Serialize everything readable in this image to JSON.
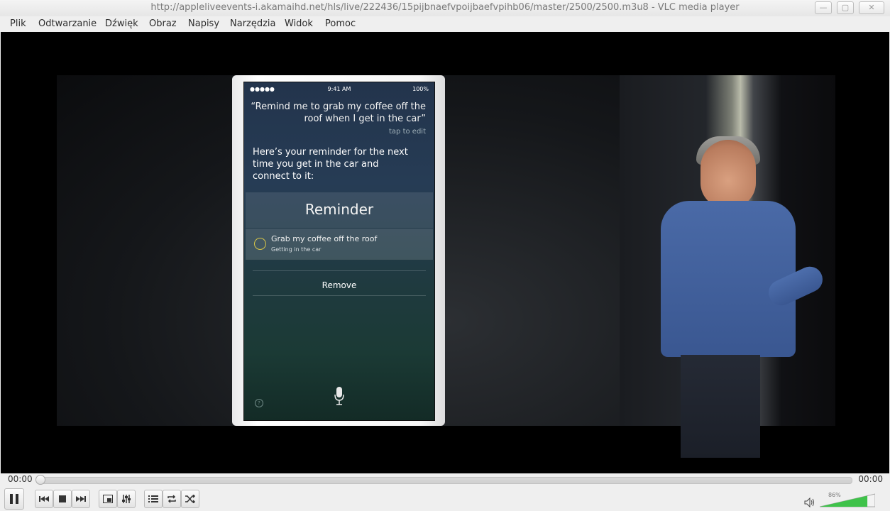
{
  "window": {
    "title": "http://appleliveevents-i.akamaihd.net/hls/live/222436/15pijbnaefvpoijbaefvpihb06/master/2500/2500.m3u8 - VLC media player",
    "buttons": {
      "minimize": "—",
      "maximize": "▢",
      "close": "✕"
    }
  },
  "menu": [
    "Plik",
    "Odtwarzanie",
    "Dźwięk",
    "Obraz",
    "Napisy",
    "Narzędzia",
    "Widok",
    "Pomoc"
  ],
  "video": {
    "phone": {
      "status_time": "9:41 AM",
      "status_signal": "●●●●● ",
      "status_battery": "100%",
      "quote": "“Remind me to grab my coffee off the roof when I get in the car”",
      "tap_to_edit": "tap to edit",
      "answer": "Here’s your reminder for the next time you get in the car and connect to it:",
      "card_title": "Reminder",
      "item_title": "Grab my coffee off the roof",
      "item_subtitle": "Getting in the car",
      "remove_label": "Remove",
      "help_glyph": "?"
    }
  },
  "playback": {
    "elapsed": "00:00",
    "total": "00:00",
    "progress": 0,
    "volume_percent": "86%",
    "volume_level": 0.86
  },
  "icons": {
    "pause": "pause-icon",
    "prev": "previous-icon",
    "stop": "stop-icon",
    "next": "next-icon",
    "fullscreen": "fullscreen-icon",
    "extended": "extended-settings-icon",
    "playlist": "playlist-icon",
    "loop": "loop-icon",
    "random": "random-icon",
    "volume": "volume-icon"
  },
  "colors": {
    "accent_green": "#3fc24a",
    "video_bg": "#000000"
  }
}
